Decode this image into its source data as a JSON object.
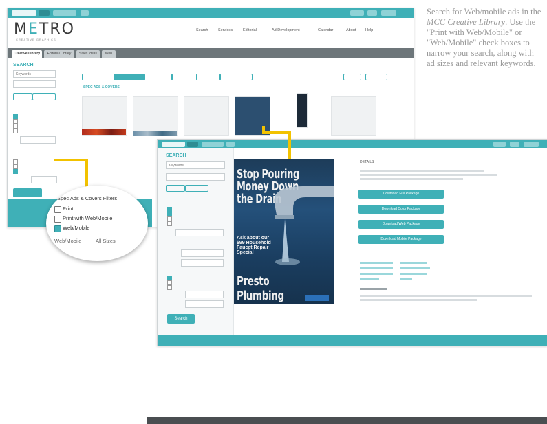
{
  "caption": {
    "line1": "Search for Web/mobile ads in the",
    "em": "MCC Creative Library",
    "line2": ". Use the \"Print with Web/Mobile\" or \"Web/Mobile\" check boxes to narrow your search, along with ad sizes and relevant keywords."
  },
  "back": {
    "logo": "METRO",
    "nav": [
      "Search",
      "Services",
      "Editorial",
      "Ad Development",
      "Calendar",
      "About",
      "Help"
    ],
    "tabs": [
      "Creative Library",
      "Editorial Library",
      "Sales Ideas",
      "Web"
    ],
    "search_title": "SEARCH",
    "keyword_value": "Keywords",
    "section_label": "SPEC ADS & COVERS"
  },
  "lens": {
    "title": "Spec Ads & Covers Filters",
    "options": [
      {
        "label": "Print",
        "checked": false
      },
      {
        "label": "Print with Web/Mobile",
        "checked": false
      },
      {
        "label": "Web/Mobile",
        "checked": true
      }
    ],
    "size_label": "Web/Mobile",
    "size_value": "All Sizes"
  },
  "front": {
    "search_title": "SEARCH",
    "keyword_value": "Keywords",
    "details_title": "DETAILS",
    "search_button": "Search",
    "downloads": [
      "Download Full Package",
      "Download Color Package",
      "Download Web Package",
      "Download Mobile Package"
    ],
    "ad": {
      "headline": "Stop Pouring Money Down the Drain",
      "offer": "Ask about our $99 Household Faucet Repair Special",
      "brand": "Presto Plumbing"
    }
  },
  "colors": {
    "accent": "#3fb0b7",
    "bar_dark": "#4a4e51"
  }
}
